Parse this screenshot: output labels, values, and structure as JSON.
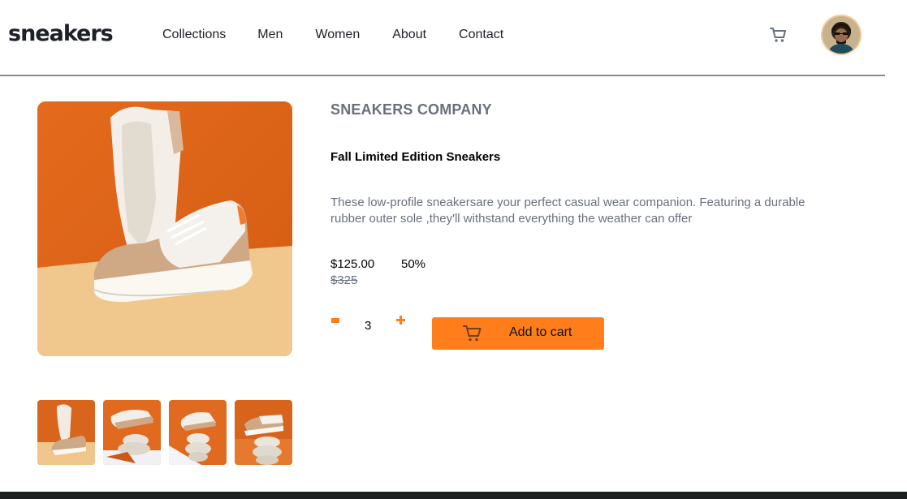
{
  "header": {
    "logo": "sneakers",
    "nav": [
      "Collections",
      "Men",
      "Women",
      "About",
      "Contact"
    ],
    "cart_icon": "cart-icon",
    "avatar_icon": "avatar"
  },
  "product": {
    "company": "SNEAKERS COMPANY",
    "title": "Fall Limited Edition Sneakers",
    "description": "These low-profile sneakersare your perfect casual wear companion. Featuring a durable rubber outer sole ,they'll withstand everything the weather can offer",
    "price": "$125.00",
    "discount": "50%",
    "old_price": "$325",
    "quantity": "3",
    "add_to_cart_label": "Add to cart"
  },
  "colors": {
    "accent": "#ff7e1b",
    "text_muted": "#68707d",
    "dark": "#1d2026"
  }
}
